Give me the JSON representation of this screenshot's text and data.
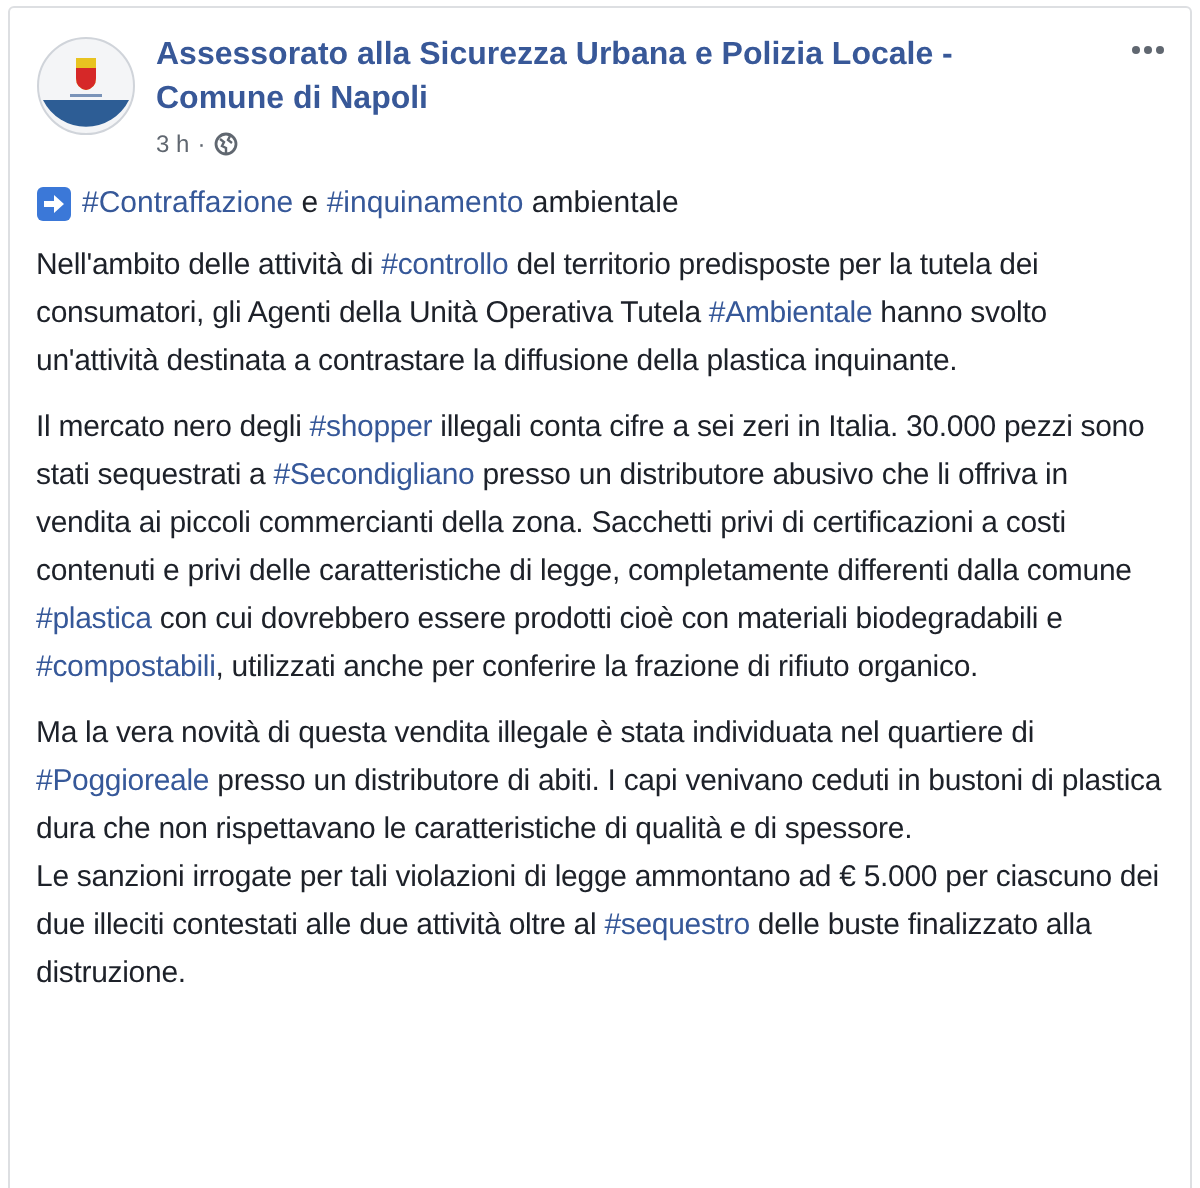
{
  "post": {
    "author": "Assessorato alla Sicurezza Urbana e Polizia Locale - Comune di Napoli",
    "time": "3 h",
    "separator": "·",
    "headline": [
      {
        "kind": "hashtag",
        "text": "#Contraffazione"
      },
      {
        "kind": "text",
        "text": " e "
      },
      {
        "kind": "hashtag",
        "text": "#inquinamento"
      },
      {
        "kind": "text",
        "text": " ambientale"
      }
    ],
    "paragraphs": [
      {
        "lines": [
          [
            {
              "kind": "text",
              "text": "Nell'ambito delle attività di "
            },
            {
              "kind": "hashtag",
              "text": "#controllo"
            },
            {
              "kind": "text",
              "text": " del territorio predisposte per la tutela dei consumatori, gli Agenti della Unità Operativa Tutela "
            },
            {
              "kind": "hashtag",
              "text": "#Ambientale"
            },
            {
              "kind": "text",
              "text": " hanno svolto un'attività destinata a contrastare la diffusione della plastica inquinante."
            }
          ]
        ]
      },
      {
        "lines": [
          [
            {
              "kind": "text",
              "text": "Il mercato nero degli "
            },
            {
              "kind": "hashtag",
              "text": "#shopper"
            },
            {
              "kind": "text",
              "text": " illegali conta cifre a sei zeri in Italia. 30.000 pezzi sono stati sequestrati a "
            },
            {
              "kind": "hashtag",
              "text": "#Secondigliano"
            },
            {
              "kind": "text",
              "text": " presso un distributore abusivo che li offriva in vendita ai piccoli commercianti della zona. Sacchetti privi di certificazioni a costi contenuti e privi delle caratteristiche di legge, completamente differenti dalla comune "
            },
            {
              "kind": "hashtag",
              "text": "#plastica"
            },
            {
              "kind": "text",
              "text": " con cui dovrebbero essere prodotti cioè con materiali biodegradabili e "
            },
            {
              "kind": "hashtag",
              "text": "#compostabili"
            },
            {
              "kind": "text",
              "text": ", utilizzati anche per conferire la frazione di rifiuto organico."
            }
          ]
        ]
      },
      {
        "lines": [
          [
            {
              "kind": "text",
              "text": "Ma la vera novità di questa vendita illegale è stata individuata nel quartiere di "
            },
            {
              "kind": "hashtag",
              "text": "#Poggioreale"
            },
            {
              "kind": "text",
              "text": " presso un distributore di abiti. I capi venivano ceduti in bustoni di plastica dura che non rispettavano le caratteristiche di qualità e di spessore."
            }
          ],
          [
            {
              "kind": "text",
              "text": "Le sanzioni irrogate per tali violazioni di legge ammontano ad € 5.000 per ciascuno dei due illeciti contestati alle due attività oltre al "
            },
            {
              "kind": "hashtag",
              "text": "#sequestro"
            },
            {
              "kind": "text",
              "text": " delle buste finalizzato alla distruzione."
            }
          ]
        ]
      }
    ]
  }
}
